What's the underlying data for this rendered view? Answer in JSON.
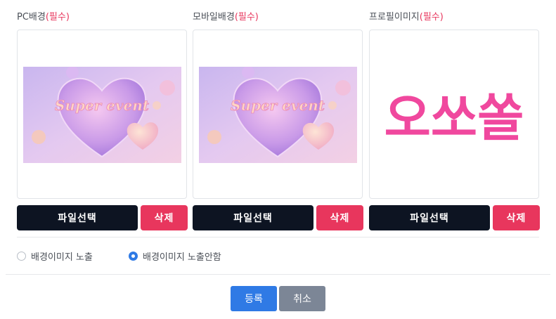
{
  "uploads": [
    {
      "label": "PC배경",
      "required": "(필수)",
      "image": "super-event-heart-banner",
      "image_text": "Super event",
      "file_button": "파일선택",
      "delete_button": "삭제"
    },
    {
      "label": "모바일배경",
      "required": "(필수)",
      "image": "super-event-heart-banner",
      "image_text": "Super event",
      "file_button": "파일선택",
      "delete_button": "삭제"
    },
    {
      "label": "프로필이미지",
      "required": "(필수)",
      "image": "ohsosol-logo",
      "image_text": "오쏘쏠",
      "file_button": "파일선택",
      "delete_button": "삭제"
    }
  ],
  "background_options": [
    {
      "label": "배경이미지 노출",
      "checked": false
    },
    {
      "label": "배경이미지 노출안함",
      "checked": true
    }
  ],
  "actions": {
    "submit": "등록",
    "cancel": "취소"
  },
  "colors": {
    "primary": "#2f7ae5",
    "danger": "#e8365d",
    "dark": "#0d1422",
    "secondary": "#7c8696",
    "logo_pink": "#f0489e"
  }
}
